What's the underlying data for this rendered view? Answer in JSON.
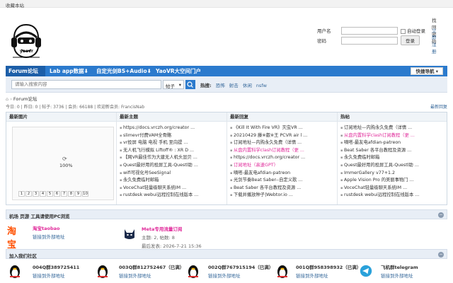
{
  "topbar": {
    "favorite": "收藏本站"
  },
  "logo": {
    "text": "yaovr"
  },
  "login": {
    "username_label": "用户名",
    "password_label": "密码",
    "auto_login": "自动登录",
    "login_button": "登录",
    "find_password": "找回密码",
    "register": "立即注册"
  },
  "nav": {
    "items": [
      "Forum论坛",
      "Lab app数据⬇",
      "自定光剑BS+Audio⬇",
      "YaoVR大空间门户"
    ],
    "quick": "快捷导航"
  },
  "search": {
    "placeholder": "请输入搜索内容",
    "type": "帖子",
    "hot_label": "热搜:",
    "hot_words": [
      "恐怖",
      "射击",
      "休闲",
      "nsfw"
    ]
  },
  "breadcrumb": {
    "text": "Forum论坛"
  },
  "stats": {
    "text": "今日: 0 | 昨日: 0 | 帖子: 3736 | 会员: 66188 | 欢迎新会员: FrancisNab",
    "newest": "最新回复"
  },
  "grid": {
    "headers": [
      "最新图片",
      "最新主题",
      "最新回复",
      "热帖"
    ],
    "loading": "100%",
    "pages": [
      "1",
      "2",
      "3",
      "4",
      "5",
      "6",
      "7",
      "8",
      "9",
      "10"
    ],
    "topics": [
      {
        "t": "https://docs.vrczh.org/creator ...",
        "pink": false
      },
      {
        "t": "slimevr付费VAM全骨骼",
        "pink": false
      },
      {
        "t": "vr投屏 电脑 电视 手机 至向提 ...",
        "pink": false
      },
      {
        "t": "无人机飞行模拟 Liftoff® : XR D ...",
        "pink": false
      },
      {
        "t": "【网VR最佳作为大建无人机头显贝 ...",
        "pink": false
      },
      {
        "t": "Quest最好用的投屏工具-Questl助 ...",
        "pink": false
      },
      {
        "t": "wifi可视化号SeeSignal",
        "pink": false
      },
      {
        "t": "永久免费临时邮箱",
        "pink": false
      },
      {
        "t": "VoceChat轻量级聊天系统IM ...",
        "pink": false
      },
      {
        "t": "rustdesk webui远程控制在线版本 ...",
        "pink": false
      }
    ],
    "replies": [
      {
        "t": "《Kill It With Fire VR》灭虫VR ...",
        "pink": false
      },
      {
        "t": "20210429 藤※叡※王 PCVR air l ...",
        "pink": false
      },
      {
        "t": "订阅地址—内购永久免费（详情 ...",
        "pink": false
      },
      {
        "t": "从盘内置科学clash订阅教程（更 ...",
        "pink": true
      },
      {
        "t": "https://docs.vrczh.org/creator ...",
        "pink": false
      },
      {
        "t": "订阅地址（高速GPT）",
        "pink": true
      },
      {
        "t": "嘀嗒-最友电afdian-patreon",
        "pink": false
      },
      {
        "t": "光剑节奏Beat Saber--自定义歌 ...",
        "pink": false
      },
      {
        "t": "Beat Saber 各平台教程及资源 ...",
        "pink": false
      },
      {
        "t": "下载并播放种子|Webtor.io ...",
        "pink": false
      }
    ],
    "hot": [
      {
        "t": "订阅地址—内购永久免费（详情 ...",
        "pink": false
      },
      {
        "t": "从盘内置科学clash订阅教程（更 ...",
        "pink": true
      },
      {
        "t": "嘀嗒-最友电afdian-patreon",
        "pink": false
      },
      {
        "t": "Beat Saber 各平台教程及资源 ...",
        "pink": false
      },
      {
        "t": "永久免费临时邮箱",
        "pink": false
      },
      {
        "t": "Quest最好用的投屏工具-Questl助 ...",
        "pink": false
      },
      {
        "t": "ImmerGallery v77+1.2",
        "pink": false
      },
      {
        "t": "Apple Vision Pro 的美丽事物门 ...",
        "pink": false
      },
      {
        "t": "VoceChat轻量级聊天系统IM ...",
        "pink": false
      },
      {
        "t": "rustdesk webui远程控制在线版本 ...",
        "pink": false
      }
    ]
  },
  "section1": {
    "title": "机场 页游 工具请使用PC浏览",
    "taobao_logo": "淘宝",
    "taobao_name": "淘宝taobao",
    "taobao_sub": "链接到外部地址",
    "meta_name": "Meta专用流量订阅",
    "meta_stats": "主题: 2, 帖数: 8",
    "meta_last": "最后发表: 2026-7-21 15:36"
  },
  "section2": {
    "title": "加入我们社区",
    "groups": [
      {
        "name": "004Q群389725411",
        "sub": "链接到外部地址"
      },
      {
        "name": "003Q群812752467（已满）",
        "sub": "链接到外部地址"
      },
      {
        "name": "002Q群767915194（已满）",
        "sub": "链接到外部地址"
      },
      {
        "name": "001Q群958398932（已满）",
        "sub": "链接到外部地址"
      },
      {
        "name": "飞机群telegram",
        "sub": "链接到外部地址"
      }
    ]
  }
}
